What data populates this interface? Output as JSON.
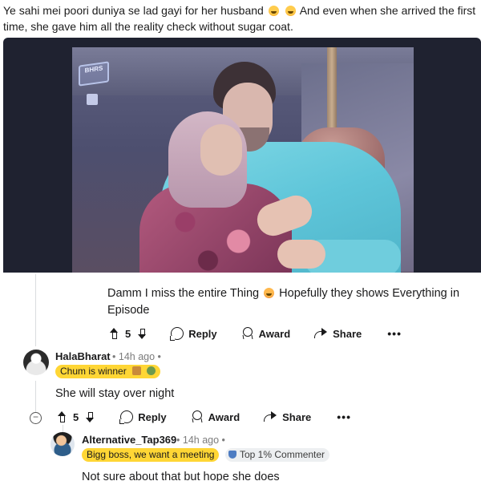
{
  "post": {
    "caption": "Ye sahi mei poori duniya se lad gayi for her husband",
    "caption_after_emojis": "And even when she arrived the first time, she gave him all the reality check without sugar coat.",
    "video_logo": "BHRS"
  },
  "comments": [
    {
      "text_part1": "Damm I miss the entire Thing",
      "text_part2": "Hopefully they shows Everything in Episode",
      "votes": "5",
      "reply_label": "Reply",
      "award_label": "Award",
      "share_label": "Share",
      "more_label": "•••"
    },
    {
      "author": "HalaBharat",
      "time": "14h ago",
      "dot": "•",
      "flair": "Chum is winner",
      "text": "She will stay over night",
      "votes": "5",
      "reply_label": "Reply",
      "award_label": "Award",
      "share_label": "Share",
      "more_label": "•••",
      "collapse_label": "−"
    },
    {
      "author": "Alternative_Tap369",
      "time": "14h ago",
      "dot": "•",
      "flair": "Bigg boss, we want a meeting",
      "badge": "Top 1% Commenter",
      "text": "Not sure about that but hope she does"
    }
  ],
  "colors": {
    "flair_bg": "#ffd635",
    "badge_bg": "#edeff1",
    "muted_text": "#7c7c7c"
  }
}
